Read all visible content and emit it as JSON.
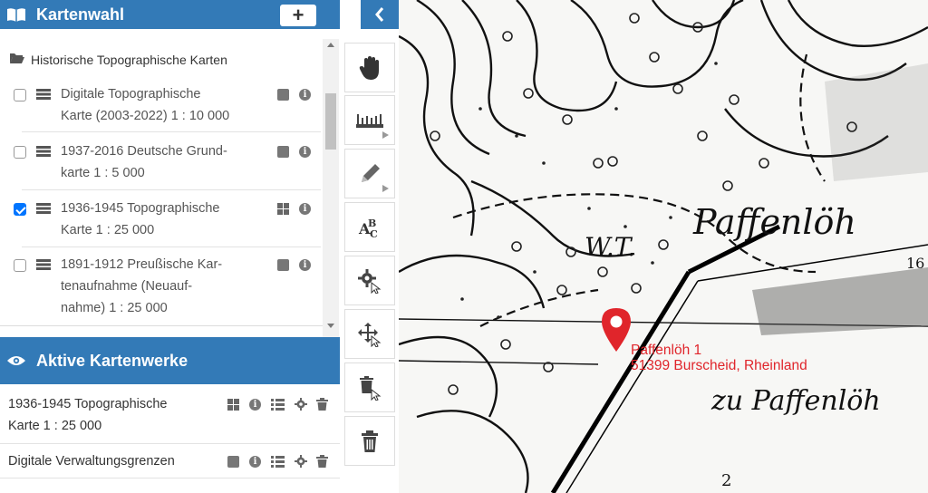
{
  "header": {
    "title": "Kartenwahl",
    "add_label": "+",
    "collapse_label": "‹"
  },
  "folder": {
    "label": "Historische Topographische Karten",
    "icon": "folder-open-icon"
  },
  "maps": [
    {
      "lines": [
        "Digitale Topographische",
        "Karte (2003-2022) 1 : 10 000"
      ],
      "checked": false,
      "indicator": "square"
    },
    {
      "lines": [
        "1937-2016 Deutsche Grund-",
        "karte 1 : 5 000"
      ],
      "checked": false,
      "indicator": "square"
    },
    {
      "lines": [
        "1936-1945 Topographische",
        "Karte 1 : 25 000"
      ],
      "checked": true,
      "indicator": "grid"
    },
    {
      "lines": [
        "1891-1912 Preußische Kar-",
        "tenaufnahme (Neuauf-",
        "nahme) 1 : 25 000"
      ],
      "checked": false,
      "indicator": "square"
    }
  ],
  "active": {
    "title": "Aktive Kartenwerke",
    "items": [
      {
        "lines": [
          "1936-1945 Topographische",
          "Karte 1 : 25 000"
        ]
      },
      {
        "lines": [
          "Digitale Verwaltungsgrenzen"
        ]
      }
    ]
  },
  "tools": [
    "pan-hand-icon",
    "measure-ruler-icon",
    "draw-pencil-icon",
    "text-abc-icon",
    "settings-gear-icon",
    "move-icon",
    "delete-select-icon",
    "trash-icon"
  ],
  "map": {
    "label_wt": "W.T.",
    "label_place": "Paffenlöh",
    "label_place2": "zu Paffenlöh",
    "label_num": "16",
    "label_num2": "2",
    "address_line1": "Paffenlöh 1",
    "address_line2": "51399 Burscheid, Rheinland",
    "marker_color": "#e0252b"
  },
  "colors": {
    "primary": "#337ab7",
    "checkbox": "#0075ff"
  }
}
